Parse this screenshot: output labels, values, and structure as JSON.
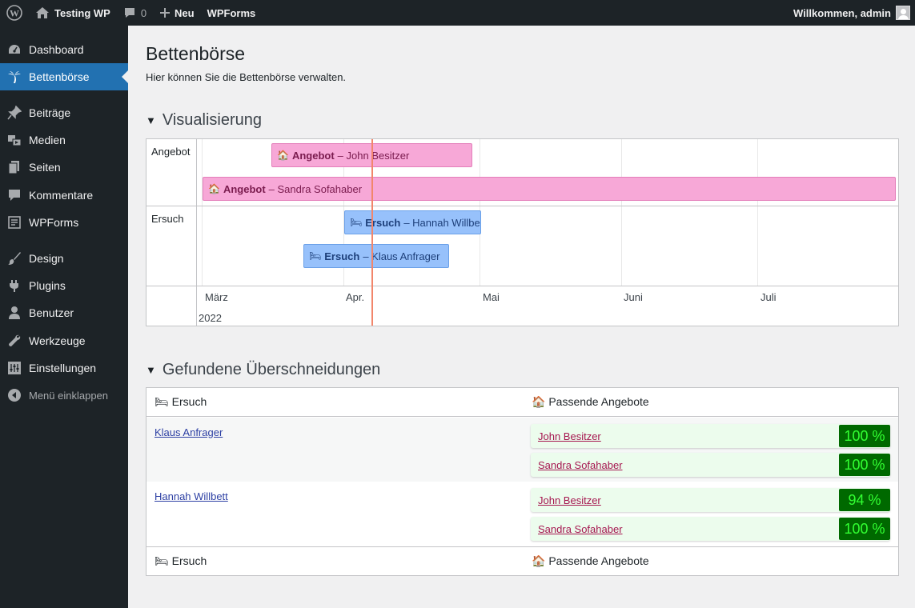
{
  "adminbar": {
    "site_name": "Testing WP",
    "comments_count": "0",
    "new_label": "Neu",
    "wpforms_label": "WPForms",
    "welcome": "Willkommen, admin"
  },
  "sidebar": {
    "items": [
      {
        "label": "Dashboard",
        "icon": "dashboard-icon"
      },
      {
        "label": "Bettenbörse",
        "icon": "palm-tree-icon",
        "active": true
      },
      {
        "label": "Beiträge",
        "icon": "pin-icon"
      },
      {
        "label": "Medien",
        "icon": "media-icon"
      },
      {
        "label": "Seiten",
        "icon": "pages-icon"
      },
      {
        "label": "Kommentare",
        "icon": "comment-icon"
      },
      {
        "label": "WPForms",
        "icon": "wpforms-icon"
      },
      {
        "label": "Design",
        "icon": "brush-icon"
      },
      {
        "label": "Plugins",
        "icon": "plugin-icon"
      },
      {
        "label": "Benutzer",
        "icon": "user-icon"
      },
      {
        "label": "Werkzeuge",
        "icon": "wrench-icon"
      },
      {
        "label": "Einstellungen",
        "icon": "settings-icon"
      },
      {
        "label": "Menü einklappen",
        "icon": "collapse-icon"
      }
    ]
  },
  "page": {
    "title": "Bettenbörse",
    "description": "Hier können Sie die Bettenbörse verwalten."
  },
  "visualization": {
    "heading": "Visualisierung",
    "groups": {
      "offer": "Angebot",
      "request": "Ersuch"
    },
    "items": [
      {
        "type": "Angebot",
        "name": "John Besitzer",
        "emoji": "🏠"
      },
      {
        "type": "Angebot",
        "name": "Sandra Sofahaber",
        "emoji": "🏠"
      },
      {
        "type": "Ersuch",
        "name": "Hannah Willbe",
        "emoji": "🛏"
      },
      {
        "type": "Ersuch",
        "name": "Klaus Anfrager",
        "emoji": "🛏"
      }
    ],
    "axis": {
      "months": [
        "März",
        "Apr.",
        "Mai",
        "Juni",
        "Juli"
      ],
      "year": "2022"
    }
  },
  "overlaps": {
    "heading": "Gefundene Überschneidungen",
    "columns": {
      "request": "Ersuch",
      "offers": "Passende Angebote"
    },
    "request_emoji": "🛏",
    "offer_emoji": "🏠",
    "rows": [
      {
        "request": "Klaus Anfrager",
        "matches": [
          {
            "name": "John Besitzer",
            "score": "100 %"
          },
          {
            "name": "Sandra Sofahaber",
            "score": "100 %"
          }
        ]
      },
      {
        "request": "Hannah Willbett",
        "matches": [
          {
            "name": "John Besitzer",
            "score": "94 %"
          },
          {
            "name": "Sandra Sofahaber",
            "score": "100 %"
          }
        ]
      }
    ]
  },
  "colors": {
    "adminbar_bg": "#1d2327",
    "active_menu": "#2271b1",
    "offer_bar": "#f7a8d7",
    "request_bar": "#97c1fb",
    "score_bg": "#006900",
    "score_text": "#32ff32",
    "now_line": "#f2866b"
  }
}
